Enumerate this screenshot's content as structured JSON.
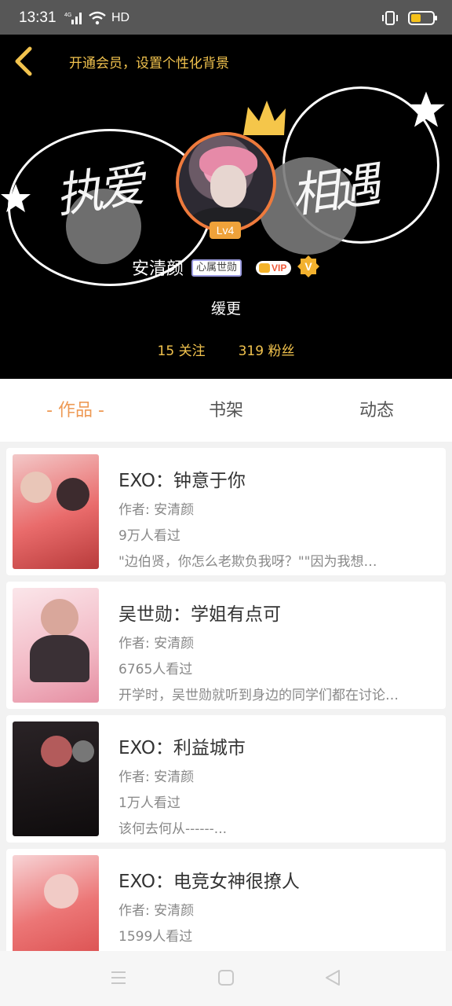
{
  "status_bar": {
    "time": "13:31",
    "network": "4G",
    "hd": "HD"
  },
  "header": {
    "promo_text": "开通会员，设置个性化背景",
    "username": "安清颜",
    "fan_badge": "心属世勋",
    "vip_label": "VIP",
    "level": "Lv4",
    "subtitle": "缓更",
    "following": "15 关注",
    "followers": "319 粉丝",
    "accent_color": "#f2c34e"
  },
  "tabs": [
    {
      "label": "- 作品 -",
      "active": true
    },
    {
      "label": "书架",
      "active": false
    },
    {
      "label": "动态",
      "active": false
    }
  ],
  "books": [
    {
      "title": "EXO：钟意于你",
      "author": "作者: 安清颜",
      "views": "9万人看过",
      "desc": "\"边伯贤，你怎么老欺负我呀？\"\"因为我想…"
    },
    {
      "title": "吴世勋：学姐有点可",
      "author": "作者: 安清颜",
      "views": "6765人看过",
      "desc": "开学时，吴世勋就听到身边的同学们都在讨论…"
    },
    {
      "title": "EXO：利益城市",
      "author": "作者: 安清颜",
      "views": "1万人看过",
      "desc": "该何去何从------..."
    },
    {
      "title": "EXO：电竞女神很撩人",
      "author": "作者: 安清颜",
      "views": "1599人看过",
      "desc": ""
    }
  ]
}
